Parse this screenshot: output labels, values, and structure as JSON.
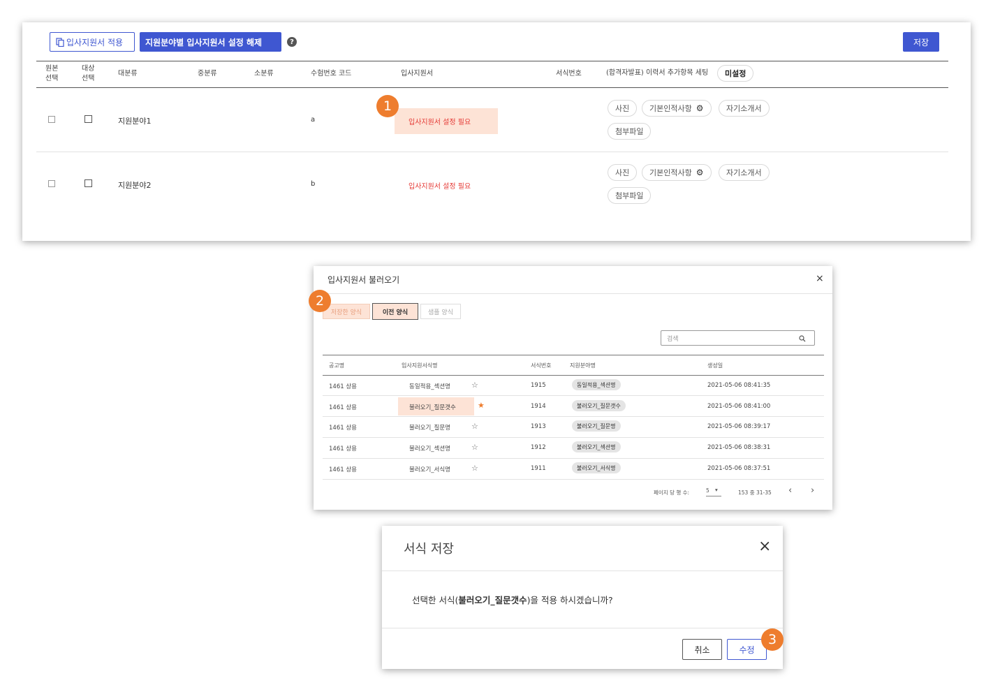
{
  "toolbar": {
    "apply_label": "입사지원서 적용",
    "release_label": "지원분야별 입사지원서 설정 해제",
    "help_symbol": "?",
    "save_label": "저장"
  },
  "table": {
    "headers": {
      "original_select": "원본\n선택",
      "target_select": "대상\n선택",
      "major": "대분류",
      "middle": "중분류",
      "minor": "소분류",
      "exam_code": "수험번호 코드",
      "application": "입사지원서",
      "form_no": "서식번호",
      "extra_setting": "(합격자발표) 이력서 추가항목 세팅",
      "unset": "미설정"
    },
    "rows": [
      {
        "major": "지원분야1",
        "code": "a",
        "application_status": "입사지원서 설정 필요",
        "chips": [
          "사진",
          "기본인적사항",
          "자기소개서",
          "첨부파일"
        ]
      },
      {
        "major": "지원분야2",
        "code": "b",
        "application_status": "입사지원서 설정 필요",
        "chips": [
          "사진",
          "기본인적사항",
          "자기소개서",
          "첨부파일"
        ]
      }
    ]
  },
  "markers": [
    "1",
    "2",
    "3"
  ],
  "load_modal": {
    "title": "입사지원서 불러오기",
    "close_symbol": "×",
    "tabs": [
      "저장한 양식",
      "이전 양식",
      "샘플 양식"
    ],
    "active_tab": "이전 양식",
    "search_placeholder": "검색",
    "headers": [
      "공고명",
      "입사지원서식명",
      "서식번호",
      "지원분야명",
      "생성일"
    ],
    "rows": [
      {
        "notice": "1461 상용",
        "form_name": "동일적용_섹션명",
        "starred": false,
        "form_no": "1915",
        "field": "동일적용_섹션명",
        "created": "2021-05-06 08:41:35"
      },
      {
        "notice": "1461 상용",
        "form_name": "불러오기_질문갯수",
        "starred": true,
        "form_no": "1914",
        "field": "불러오기_질문갯수",
        "created": "2021-05-06 08:41:00"
      },
      {
        "notice": "1461 상용",
        "form_name": "불러오기_질문명",
        "starred": false,
        "form_no": "1913",
        "field": "불러오기_질문명",
        "created": "2021-05-06 08:39:17"
      },
      {
        "notice": "1461 상용",
        "form_name": "불러오기_섹션명",
        "starred": false,
        "form_no": "1912",
        "field": "불러오기_섹션명",
        "created": "2021-05-06 08:38:31"
      },
      {
        "notice": "1461 상용",
        "form_name": "불러오기_서식명",
        "starred": false,
        "form_no": "1911",
        "field": "불러오기_서식명",
        "created": "2021-05-06 08:37:51"
      }
    ],
    "pagination": {
      "rows_per_page_label": "페이지 당 행 수:",
      "rows_per_page": "5",
      "range": "153 중 31-35",
      "prev_symbol": "‹",
      "next_symbol": "›"
    }
  },
  "save_modal": {
    "title": "서식 저장",
    "close_symbol": "×",
    "message_prefix": "선택한 서식(",
    "message_bold": "불러오기_질문갯수",
    "message_suffix": ")을 적용 하시겠습니까?",
    "cancel_label": "취소",
    "confirm_label": "수정"
  },
  "colors": {
    "primary": "#3f57d1",
    "warning_text": "#e53935",
    "highlight": "#fde3d6",
    "marker": "#ee7d2e"
  }
}
